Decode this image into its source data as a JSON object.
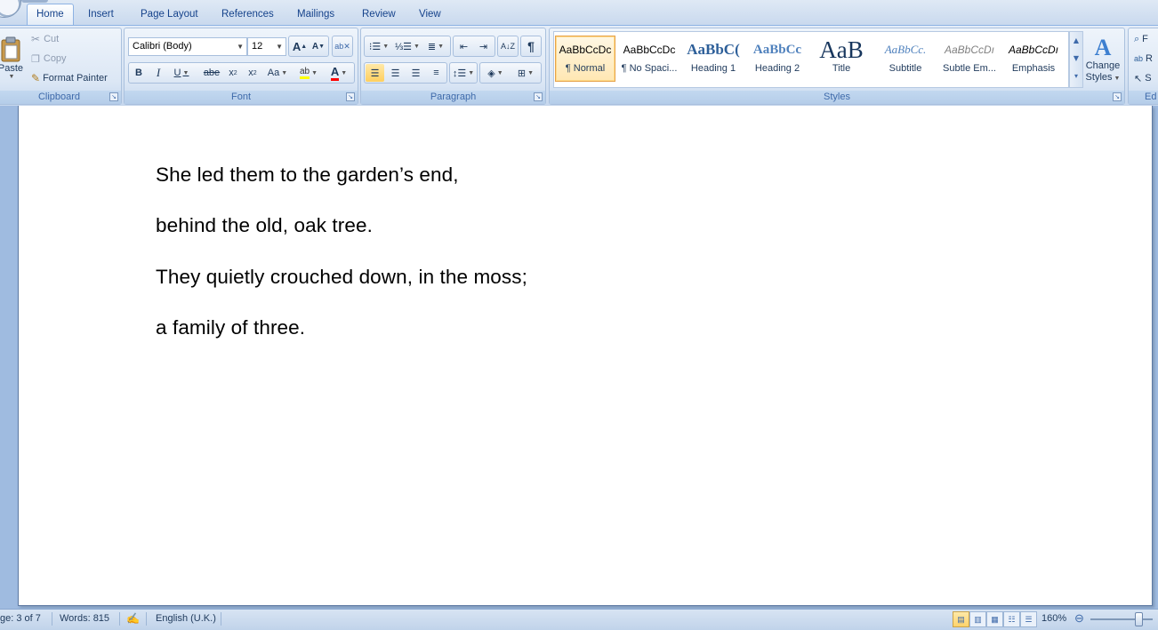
{
  "tabs": [
    "Home",
    "Insert",
    "Page Layout",
    "References",
    "Mailings",
    "Review",
    "View"
  ],
  "active_tab": "Home",
  "clipboard": {
    "paste_label": "Paste",
    "cut_label": "Cut",
    "copy_label": "Copy",
    "format_painter_label": "Format Painter",
    "group_label": "Clipboard"
  },
  "font": {
    "family": "Calibri (Body)",
    "size": "12",
    "group_label": "Font"
  },
  "paragraph": {
    "group_label": "Paragraph"
  },
  "styles": {
    "group_label": "Styles",
    "items": [
      {
        "sample": "AaBbCcDc",
        "name": "¶ Normal"
      },
      {
        "sample": "AaBbCcDc",
        "name": "¶ No Spaci..."
      },
      {
        "sample": "AaBbC(",
        "name": "Heading 1"
      },
      {
        "sample": "AaBbCc",
        "name": "Heading 2"
      },
      {
        "sample": "AaB",
        "name": "Title"
      },
      {
        "sample": "AaBbCc.",
        "name": "Subtitle"
      },
      {
        "sample": "AaBbCcDı",
        "name": "Subtle Em..."
      },
      {
        "sample": "AaBbCcDı",
        "name": "Emphasis"
      }
    ],
    "change_styles_line1": "Change",
    "change_styles_line2": "Styles"
  },
  "editing": {
    "find_label": "F",
    "replace_label": "R",
    "select_label": "S",
    "group_label": "Ed"
  },
  "document": {
    "lines": [
      "She led them to the garden’s end,",
      "behind the old, oak tree.",
      "They quietly crouched down, in the moss;",
      "a family of three."
    ]
  },
  "status": {
    "page": "ge: 3 of 7",
    "words": "Words: 815",
    "language": "English (U.K.)",
    "zoom": "160%"
  },
  "colors": {
    "accent": "#15428b",
    "highlight": "#ffff00",
    "font_color": "#ff0000"
  }
}
